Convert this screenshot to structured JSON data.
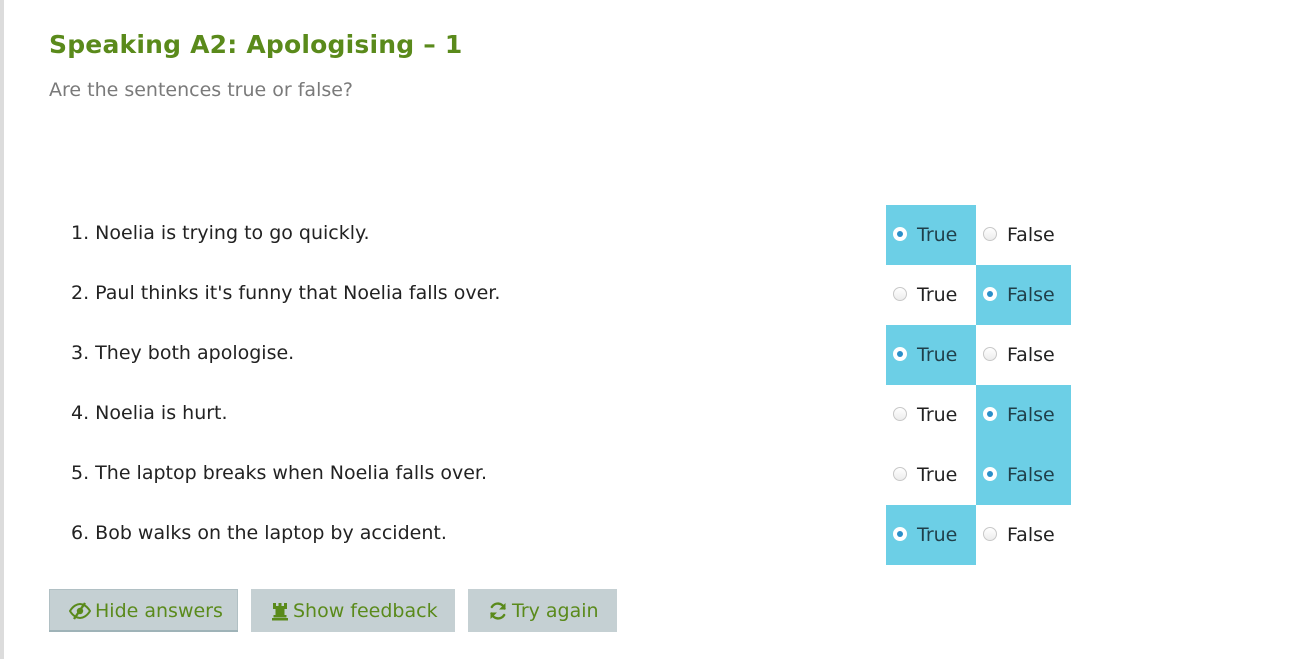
{
  "title": "Speaking A2: Apologising – 1",
  "subtitle": "Are the sentences true or false?",
  "option_true": "True",
  "option_false": "False",
  "colors": {
    "title": "#5a8a1b",
    "selected_bg": "#6ccfe6",
    "button_bg": "#c5d0d3"
  },
  "questions": [
    {
      "text": "1. Noelia is trying to go quickly.",
      "selected": "True"
    },
    {
      "text": "2. Paul thinks it's funny that Noelia falls over.",
      "selected": "False"
    },
    {
      "text": "3. They both apologise.",
      "selected": "True"
    },
    {
      "text": "4. Noelia is hurt.",
      "selected": "False"
    },
    {
      "text": "5. The laptop breaks when Noelia falls over.",
      "selected": "False"
    },
    {
      "text": "6. Bob walks on the laptop by accident.",
      "selected": "True"
    }
  ],
  "buttons": {
    "hide_answers": {
      "label": "Hide answers",
      "icon": "eye-slash-icon"
    },
    "show_feedback": {
      "label": "Show feedback",
      "icon": "rook-icon"
    },
    "try_again": {
      "label": "Try again",
      "icon": "refresh-icon"
    }
  }
}
